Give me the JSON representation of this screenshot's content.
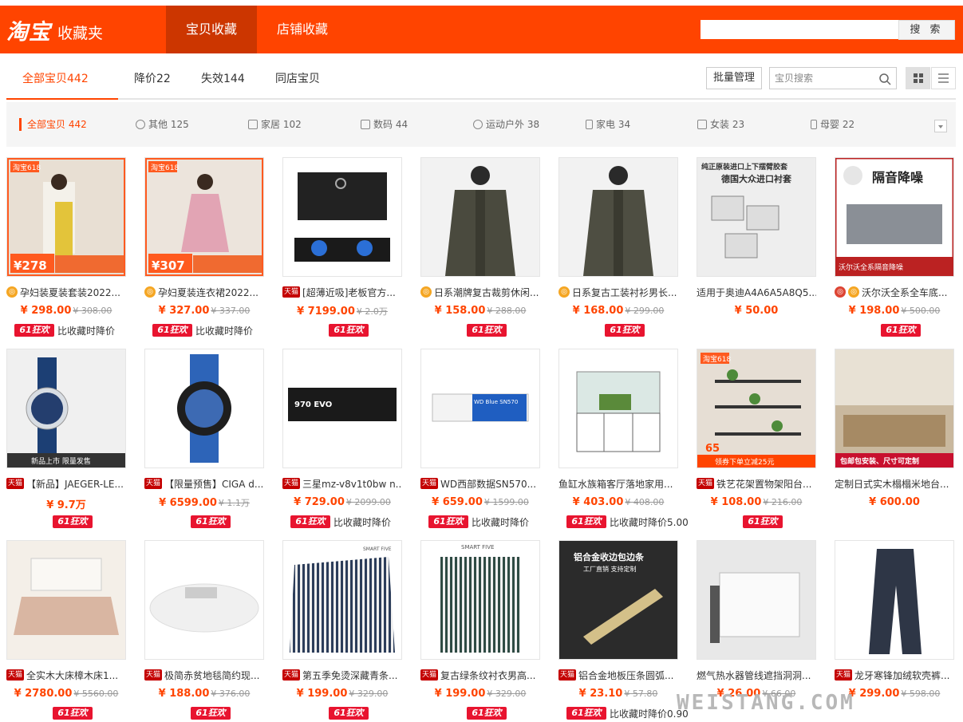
{
  "header": {
    "logo_main": "淘宝",
    "logo_sub": "收藏夹",
    "nav": [
      "宝贝收藏",
      "店铺收藏"
    ],
    "search_button": "搜 索",
    "bg_color": "#ff4400"
  },
  "tabs": {
    "items": [
      "全部宝贝442",
      "降价22",
      "失效144",
      "同店宝贝"
    ],
    "batch_button": "批量管理",
    "item_search_placeholder": "宝贝搜索"
  },
  "categories": [
    {
      "label": "全部宝贝 442",
      "icon": "none"
    },
    {
      "label": "其他 125",
      "icon": "plus-circle-icon"
    },
    {
      "label": "家居 102",
      "icon": "home-icon"
    },
    {
      "label": "数码 44",
      "icon": "tablet-icon"
    },
    {
      "label": "运动户外 38",
      "icon": "globe-icon"
    },
    {
      "label": "家电 34",
      "icon": "fridge-icon"
    },
    {
      "label": "女装 23",
      "icon": "dress-icon"
    },
    {
      "label": "母婴 22",
      "icon": "bottle-icon"
    }
  ],
  "products": [
    {
      "title": "孕妇装夏装套装2022...",
      "badge": "gold",
      "price": "¥ 298.00",
      "orig": "¥ 308.00",
      "promo": "61狂欢",
      "note": "比收藏时降价"
    },
    {
      "title": "孕妇夏装连衣裙2022...",
      "badge": "gold",
      "price": "¥ 327.00",
      "orig": "¥ 337.00",
      "promo": "61狂欢",
      "note": "比收藏时降价"
    },
    {
      "title": "[超薄近吸]老板官方...",
      "badge": "tmall",
      "price": "¥ 7199.00",
      "orig": "¥ 2.0万",
      "promo": "61狂欢",
      "note": ""
    },
    {
      "title": "日系潮牌复古裁剪休闲...",
      "badge": "gold",
      "price": "¥ 158.00",
      "orig": "¥ 288.00",
      "promo": "61狂欢",
      "note": ""
    },
    {
      "title": "日系复古工装衬衫男长...",
      "badge": "gold",
      "price": "¥ 168.00",
      "orig": "¥ 299.00",
      "promo": "61狂欢",
      "note": ""
    },
    {
      "title": "适用于奥迪A4A6A5A8Q5...",
      "badge": "",
      "price": "¥ 50.00",
      "orig": "",
      "promo": "",
      "note": ""
    },
    {
      "title": "沃尔沃全系全车底...",
      "badge": "red",
      "price": "¥ 198.00",
      "orig": "¥ 500.00",
      "promo": "61狂欢",
      "note": ""
    },
    {
      "title": "【新品】JAEGER-LE...",
      "badge": "tmall",
      "price": "¥ 9.7万",
      "orig": "",
      "promo": "61狂欢",
      "note": ""
    },
    {
      "title": "【限量预售】CIGA d...",
      "badge": "tmall",
      "price": "¥ 6599.00",
      "orig": "¥ 1.1万",
      "promo": "61狂欢",
      "note": ""
    },
    {
      "title": "三星mz-v8v1t0bw n...",
      "badge": "tmall",
      "price": "¥ 729.00",
      "orig": "¥ 2099.00",
      "promo": "61狂欢",
      "note": "比收藏时降价"
    },
    {
      "title": "WD西部数据SN570...",
      "badge": "tmall",
      "price": "¥ 659.00",
      "orig": "¥ 1599.00",
      "promo": "61狂欢",
      "note": "比收藏时降价"
    },
    {
      "title": "鱼缸水族箱客厅落地家用...",
      "badge": "",
      "price": "¥ 403.00",
      "orig": "¥ 408.00",
      "promo": "61狂欢",
      "note": "比收藏时降价5.00"
    },
    {
      "title": "铁艺花架置物架阳台...",
      "badge": "tmall",
      "price": "¥ 108.00",
      "orig": "¥ 216.00",
      "promo": "61狂欢",
      "note": ""
    },
    {
      "title": "定制日式实木榻榻米地台...",
      "badge": "",
      "price": "¥ 600.00",
      "orig": "",
      "promo": "",
      "note": ""
    },
    {
      "title": "全实木大床樟木床1...",
      "badge": "tmall",
      "price": "¥ 2780.00",
      "orig": "¥ 5560.00",
      "promo": "61狂欢",
      "note": ""
    },
    {
      "title": "极简赤贫地毯简约现...",
      "badge": "tmall",
      "price": "¥ 188.00",
      "orig": "¥ 376.00",
      "promo": "61狂欢",
      "note": ""
    },
    {
      "title": "第五季免烫深藏青条...",
      "badge": "tmall",
      "price": "¥ 199.00",
      "orig": "¥ 329.00",
      "promo": "61狂欢",
      "note": ""
    },
    {
      "title": "复古绿条纹衬衣男高...",
      "badge": "tmall",
      "price": "¥ 199.00",
      "orig": "¥ 329.00",
      "promo": "61狂欢",
      "note": ""
    },
    {
      "title": "铝合金地板压条圆弧...",
      "badge": "tmall",
      "price": "¥ 23.10",
      "orig": "¥ 57.80",
      "promo": "61狂欢",
      "note": "比收藏时降价0.90"
    },
    {
      "title": "燃气热水器管线遮挡洞洞...",
      "badge": "",
      "price": "¥ 26.00",
      "orig": "¥ 66.00",
      "promo": "",
      "note": ""
    },
    {
      "title": "龙牙寒锋加绒软壳裤...",
      "badge": "tmall",
      "price": "¥ 299.00",
      "orig": "¥ 598.00",
      "promo": "",
      "note": ""
    }
  ],
  "thumb_texts": {
    "tb618": "淘宝618",
    "p1_price": "278",
    "p2_price": "307",
    "audi_top": "纯正原装进口上下摆臂胶套",
    "audi_sub": "德国大众进口衬套",
    "volvo_banner": "隔音降噪",
    "volvo_foot": "沃尔沃全系隔音降噪",
    "jaeger_foot": "新品上市 限量发售",
    "evo": "970 EVO",
    "sn570": "WD Blue SN570",
    "flower_price": "65",
    "flower_foot": "领券下单立减25元",
    "tatami_foot": "包邮包安装、尺寸可定制",
    "shirt_brand": "SMART FIVE",
    "alu_title": "铝合金收边包边条",
    "alu_sub": "工厂直销 支持定制"
  },
  "watermark": "WEISTANG.COM"
}
